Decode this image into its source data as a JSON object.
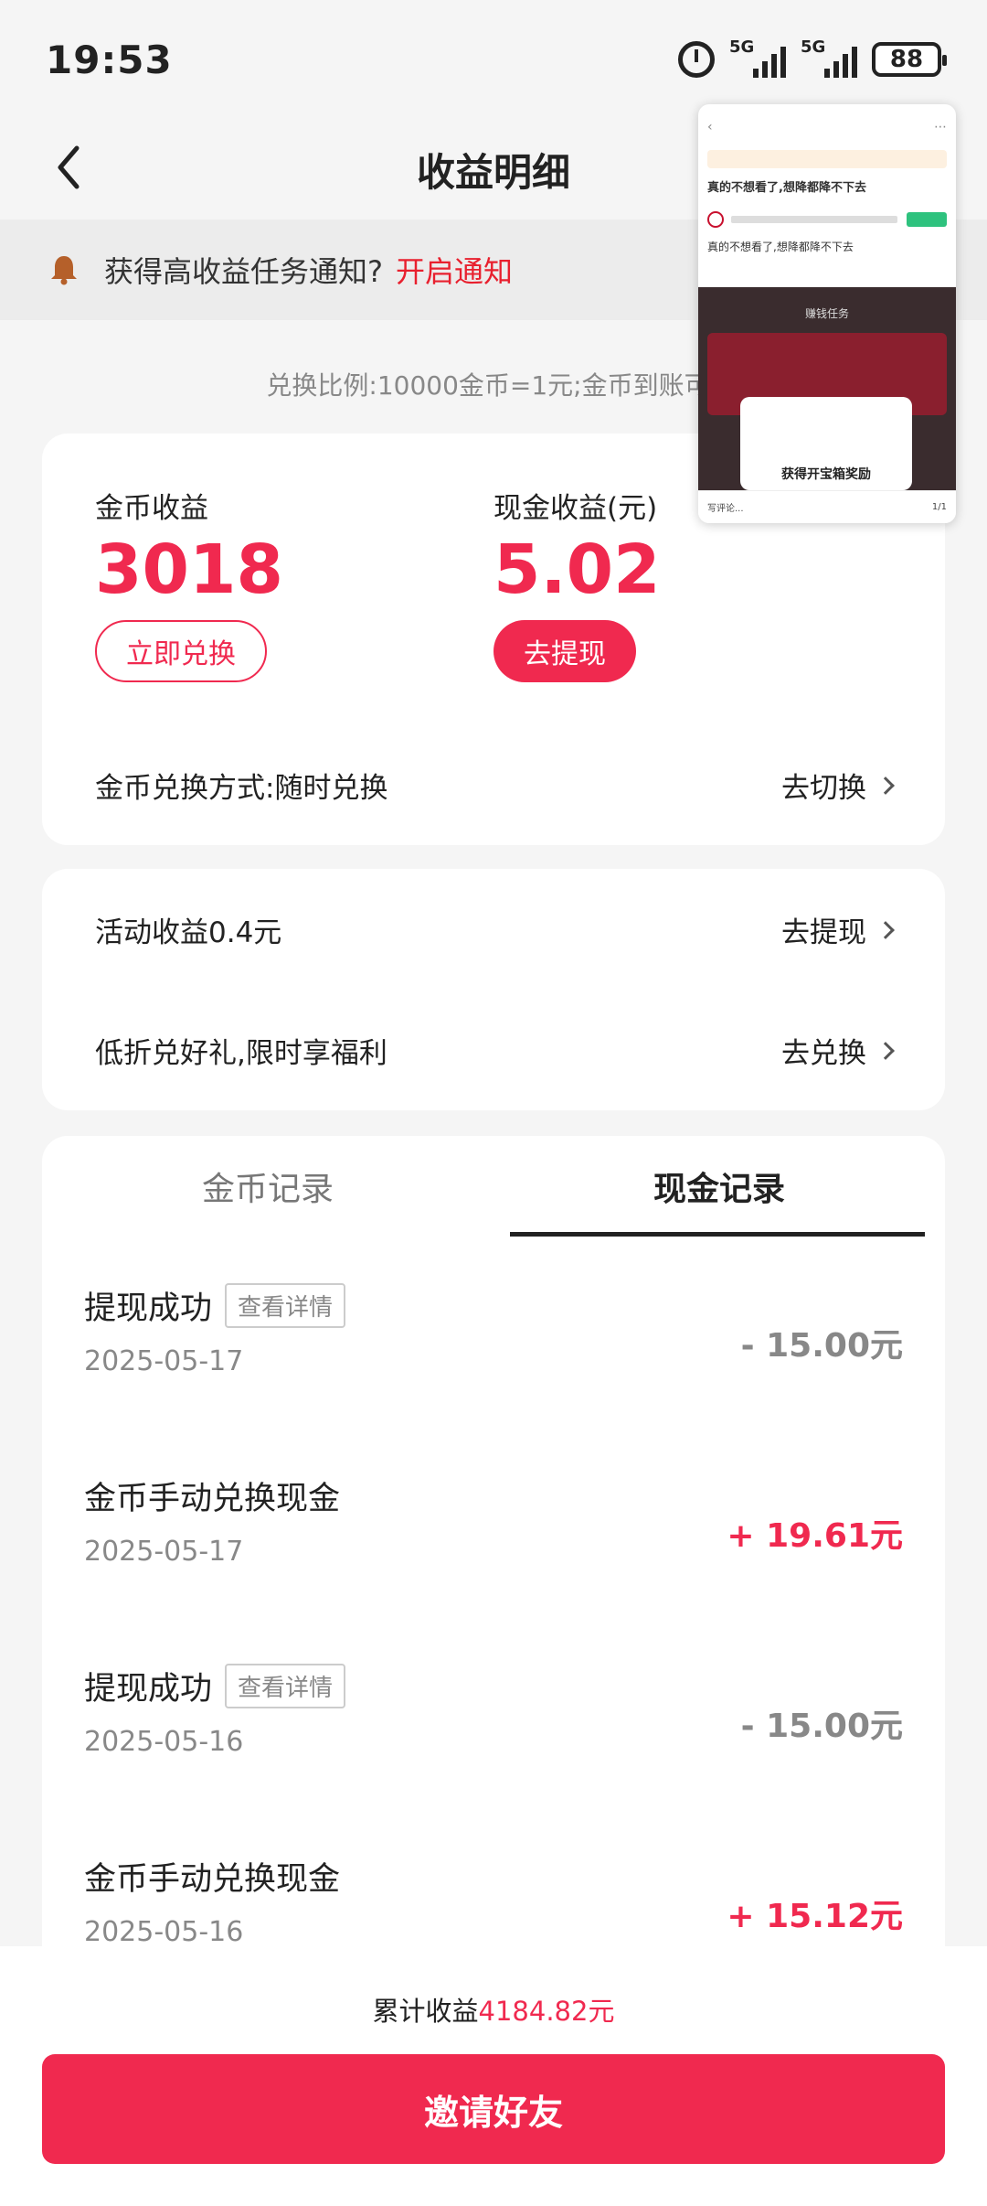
{
  "status_bar": {
    "time": "19:53",
    "network1": "5G",
    "network2": "5G",
    "battery": "88"
  },
  "header": {
    "title": "收益明细"
  },
  "notice": {
    "text": "获得高收益任务通知?",
    "link": "开启通知"
  },
  "ratio_text": "兑换比例:10000金币=1元;金币到账可能有延迟",
  "earnings": {
    "coin_label": "金币收益",
    "coin_value": "3018",
    "coin_button": "立即兑换",
    "cash_label": "现金收益(元)",
    "cash_value": "5.02",
    "cash_button": "去提现",
    "exchange_mode_label": "金币兑换方式:随时兑换",
    "exchange_mode_action": "去切换"
  },
  "activity": {
    "items": [
      {
        "label": "活动收益0.4元",
        "action": "去提现"
      },
      {
        "label": "低折兑好礼,限时享福利",
        "action": "去兑换"
      }
    ]
  },
  "records": {
    "tabs": [
      {
        "label": "金币记录",
        "active": false
      },
      {
        "label": "现金记录",
        "active": true
      }
    ],
    "items": [
      {
        "title": "提现成功",
        "tag": "查看详情",
        "date": "2025-05-17",
        "amount": "- 15.00元"
      },
      {
        "title": "金币手动兑换现金",
        "tag": "",
        "date": "2025-05-17",
        "amount": "+ 19.61元"
      },
      {
        "title": "提现成功",
        "tag": "查看详情",
        "date": "2025-05-16",
        "amount": "- 15.00元"
      },
      {
        "title": "金币手动兑换现金",
        "tag": "",
        "date": "2025-05-16",
        "amount": "+ 15.12元"
      }
    ]
  },
  "footer": {
    "total_label": "累计收益",
    "total_value": "4184.82元",
    "invite_button": "邀请好友"
  },
  "overlay": {
    "headline": "真的不想看了,想降都降不下去",
    "caption": "真的不想看了,想降都降不下去",
    "tab_label": "赚钱任务",
    "popup_text": "获得开宝箱奖励",
    "comment_placeholder": "写评论...",
    "page_indicator": "1/1"
  },
  "colors": {
    "accent": "#f0294f",
    "notice_link": "#e8202e"
  }
}
